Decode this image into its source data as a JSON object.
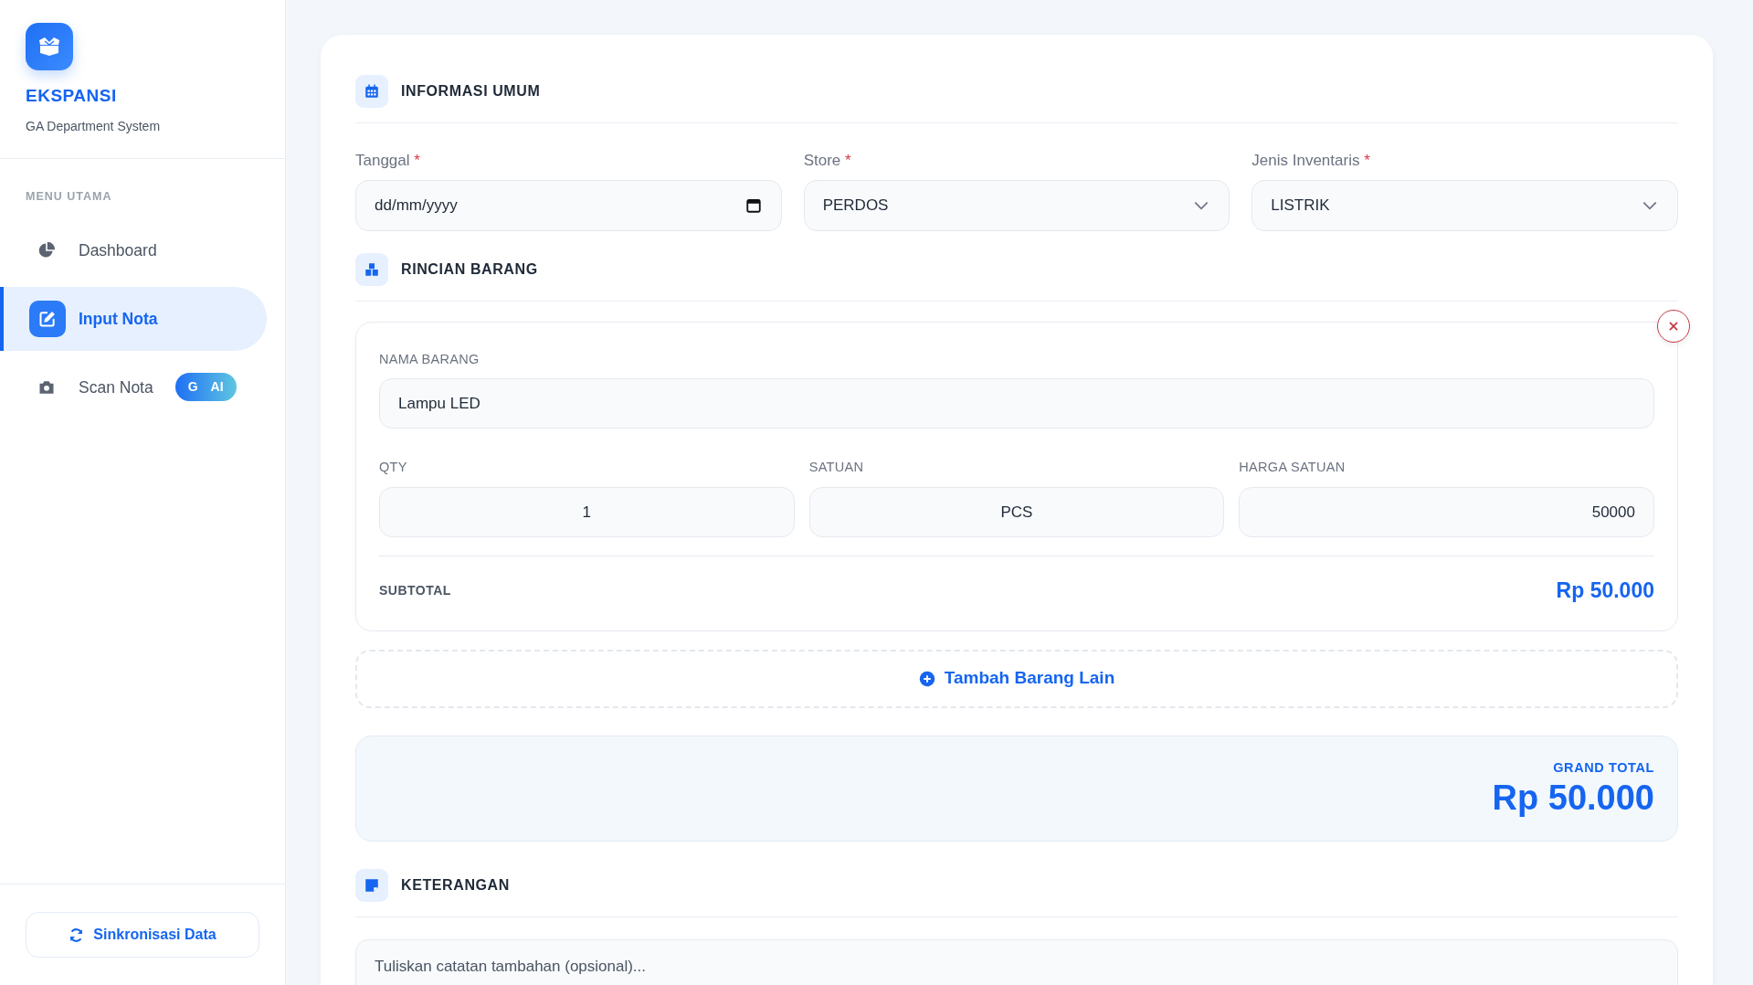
{
  "sidebar": {
    "brand": "EKSPANSI",
    "subtitle": "GA Department System",
    "section_label": "MENU UTAMA",
    "items": [
      {
        "label": "Dashboard",
        "selected": false
      },
      {
        "label": "Input Nota",
        "selected": true
      },
      {
        "label": "Scan Nota",
        "selected": false,
        "badge": {
          "letter": "G",
          "text": "AI"
        }
      }
    ],
    "sync_button": "Sinkronisasi Data"
  },
  "general": {
    "title": "INFORMASI UMUM",
    "fields": [
      {
        "label": "Tanggal",
        "required_mark": "*",
        "kind": "date",
        "placeholder": "dd/mm/yyyy"
      },
      {
        "label": "Store",
        "required_mark": "*",
        "kind": "select",
        "value": "PERDOS"
      },
      {
        "label": "Jenis Inventaris",
        "required_mark": "*",
        "kind": "select",
        "value": "LISTRIK"
      }
    ]
  },
  "items": {
    "title": "RINCIAN BARANG",
    "rows": [
      {
        "name_label": "NAMA BARANG",
        "name": "Lampu LED",
        "qty_label": "QTY",
        "qty": "1",
        "unit_label": "SATUAN",
        "unit": "PCS",
        "price_label": "HARGA SATUAN",
        "price": "50000",
        "subtotal_label": "SUBTOTAL",
        "subtotal": "Rp 50.000"
      }
    ],
    "add_button": "Tambah Barang Lain"
  },
  "grand_total": {
    "label": "GRAND TOTAL",
    "value": "Rp 50.000"
  },
  "notes": {
    "title": "KETERANGAN",
    "placeholder": "Tuliskan catatan tambahan (opsional)..."
  }
}
